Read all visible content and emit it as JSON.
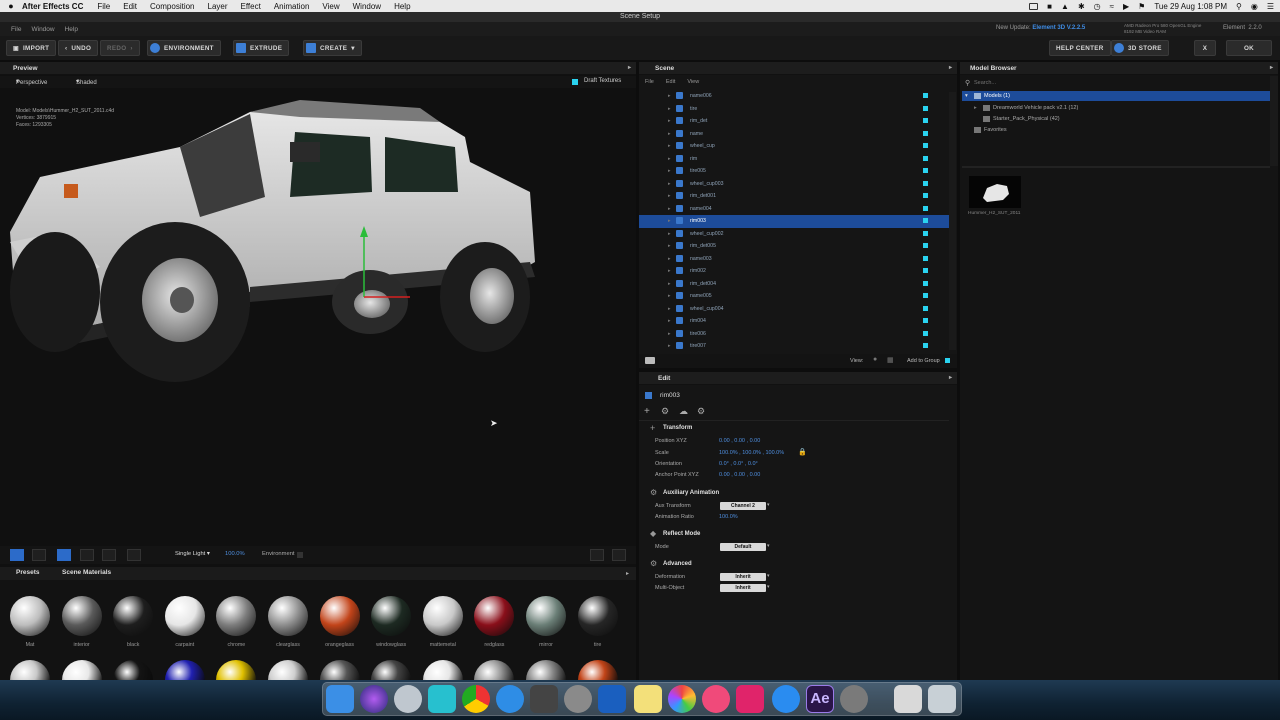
{
  "mac_menubar": {
    "app_name": "After Effects CC",
    "items": [
      "File",
      "Edit",
      "Composition",
      "Layer",
      "Effect",
      "Animation",
      "View",
      "Window",
      "Help"
    ],
    "clock": "Tue 29 Aug  1:08 PM"
  },
  "window": {
    "title": "Scene Setup",
    "menu": [
      "File",
      "Window",
      "Help"
    ],
    "update_prefix": "New Update:",
    "update_version": "Element 3D V.2.2.5",
    "gpu_line1": "AMD Radeon Pro 580 OpenGL Engine",
    "gpu_line2": "8192 MB Video RAM",
    "brand": "Element",
    "brand_version": "2.2.0"
  },
  "toolbar": {
    "import": "IMPORT",
    "undo": "UNDO",
    "redo": "REDO",
    "environment": "ENVIRONMENT",
    "extrude": "EXTRUDE",
    "create": "CREATE",
    "help_center": "HELP CENTER",
    "store": "3D STORE",
    "close": "X",
    "ok": "OK"
  },
  "preview": {
    "title": "Preview",
    "camera": "Perspective",
    "shading": "Shaded",
    "draft_textures": "Draft Textures",
    "stats": {
      "model_label": "Model:",
      "model": "Models\\Hummer_H2_SUT_2011.c4d",
      "vertices_label": "Vertices:",
      "vertices": "3879915",
      "faces_label": "Faces:",
      "faces": "1293305"
    },
    "light_mode": "Single Light",
    "light_value": "100.0%",
    "environment": "Environment"
  },
  "presets": {
    "tab_presets": "Presets",
    "tab_scene_materials": "Scene Materials",
    "materials": [
      {
        "name": "Mat",
        "color": "#bdbdbd"
      },
      {
        "name": "interior",
        "color": "#5a5a5a"
      },
      {
        "name": "black",
        "color": "#1e1e1e"
      },
      {
        "name": "carpaint",
        "color": "#e6e6e6"
      },
      {
        "name": "chrome",
        "color": "#7d7d7d"
      },
      {
        "name": "clearglass",
        "color": "#8e8e8e"
      },
      {
        "name": "orangeglass",
        "color": "#c2441a"
      },
      {
        "name": "windowglass",
        "color": "#1d2a22"
      },
      {
        "name": "mattemetal",
        "color": "#c9c9c9"
      },
      {
        "name": "redglass",
        "color": "#8a0f1a"
      },
      {
        "name": "mirror",
        "color": "#6b7f77"
      },
      {
        "name": "tire",
        "color": "#262626"
      }
    ]
  },
  "scene": {
    "title": "Scene",
    "menu": [
      "File",
      "Edit",
      "View"
    ],
    "items": [
      "name006",
      "tire",
      "rim_det",
      "name",
      "wheel_cup",
      "rim",
      "tire005",
      "wheel_cup003",
      "rim_det001",
      "name004",
      "rim003",
      "wheel_cup002",
      "rim_det005",
      "name003",
      "rim002",
      "rim_det004",
      "name005",
      "wheel_cup004",
      "rim004",
      "tire006",
      "tire007"
    ],
    "selected_index": 10,
    "view_label": "View:",
    "add_to_group": "Add to Group"
  },
  "edit": {
    "title": "Edit",
    "object_name": "rim003",
    "transform": {
      "title": "Transform",
      "position_label": "Position XYZ",
      "position": "0.00 ,  0.00 ,  0.00",
      "scale_label": "Scale",
      "scale": "100.0% ,  100.0% ,  100.0%",
      "orientation_label": "Orientation",
      "orientation": "0.0° ,  0.0° ,  0.0°",
      "anchor_label": "Anchor Point XYZ",
      "anchor": "0.00 ,  0.00 ,  0.00"
    },
    "aux": {
      "title": "Auxiliary Animation",
      "transform_label": "Aux Transform",
      "transform_value": "Channel 2",
      "ratio_label": "Animation Ratio",
      "ratio_value": "100.0%"
    },
    "reflect": {
      "title": "Reflect Mode",
      "mode_label": "Mode",
      "mode_value": "Default"
    },
    "advanced": {
      "title": "Advanced",
      "deformation_label": "Deformation",
      "deformation_value": "Inherit",
      "multi_label": "Multi-Object",
      "multi_value": "Inherit"
    }
  },
  "model_browser": {
    "title": "Model Browser",
    "search_placeholder": "Search...",
    "tree": {
      "models": "Models (1)",
      "pack1": "Dreamworld Vehicle pack v2.1 (12)",
      "pack2": "Starter_Pack_Physical (42)",
      "favorites": "Favorites"
    },
    "thumb_label": "Hummer_H2_SUT_2011"
  },
  "colors": {
    "accent": "#2c6bc9",
    "selection": "#1d4c9a",
    "cyan_check": "#2ad3f0"
  }
}
